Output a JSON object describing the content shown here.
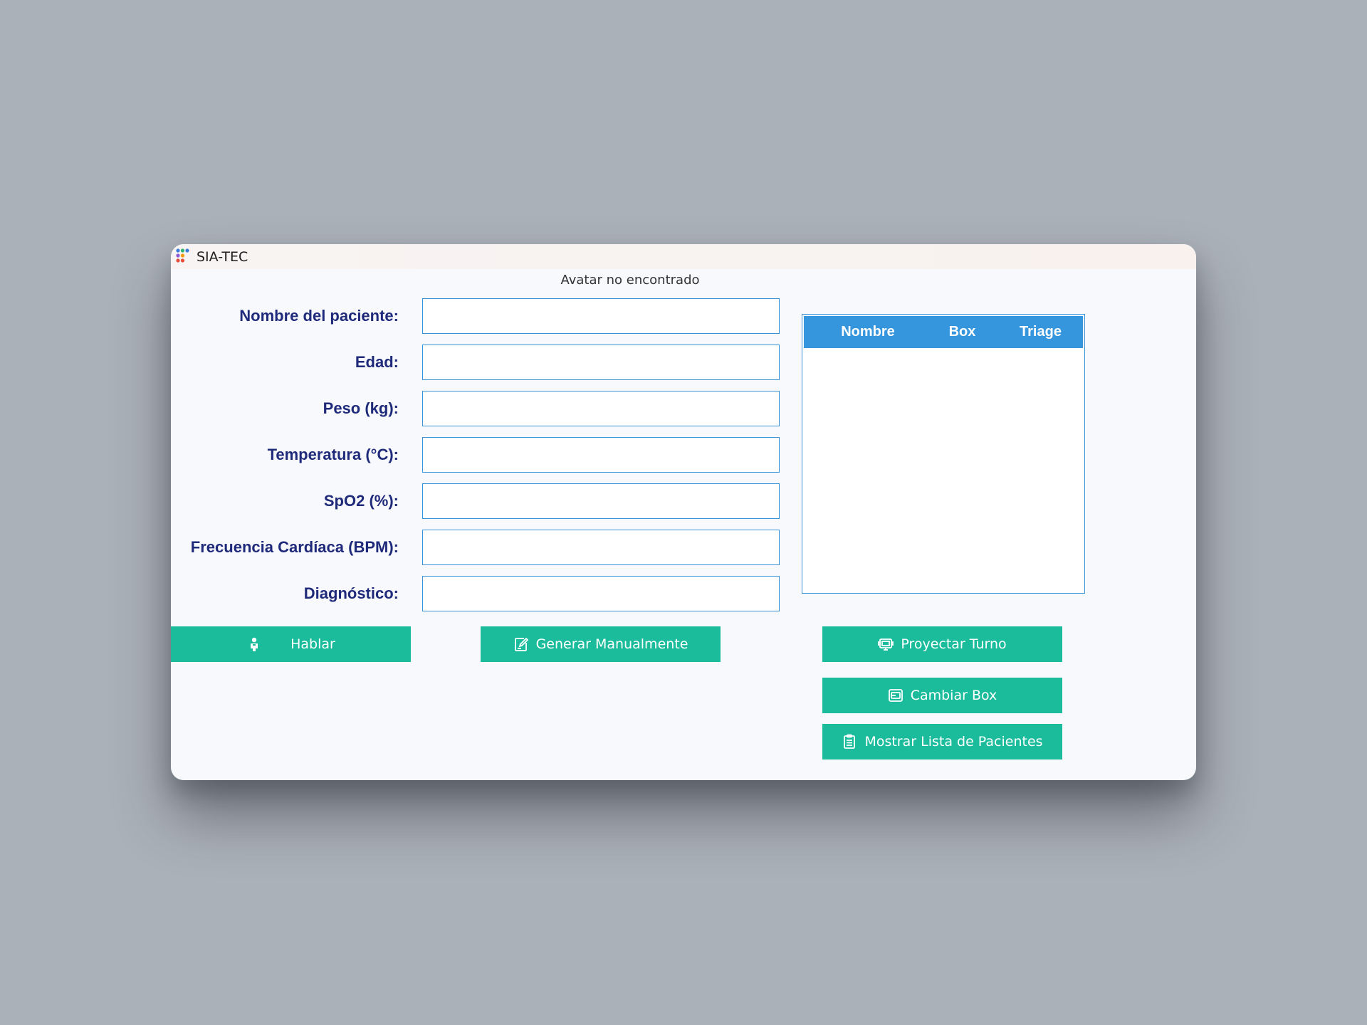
{
  "window": {
    "title": "SIA-TEC"
  },
  "avatar_message": "Avatar no encontrado",
  "form": {
    "fields": [
      {
        "label": "Nombre del paciente:",
        "value": "",
        "placeholder": ""
      },
      {
        "label": "Edad:",
        "value": "",
        "placeholder": ""
      },
      {
        "label": "Peso (kg):",
        "value": "",
        "placeholder": ""
      },
      {
        "label": "Temperatura (°C):",
        "value": "",
        "placeholder": ""
      },
      {
        "label": "SpO2 (%):",
        "value": "",
        "placeholder": ""
      },
      {
        "label": "Frecuencia Cardíaca (BPM):",
        "value": "",
        "placeholder": ""
      },
      {
        "label": "Diagnóstico:",
        "value": "",
        "placeholder": ""
      }
    ]
  },
  "patients_table": {
    "columns": [
      "Nombre",
      "Box",
      "Triage"
    ],
    "rows": []
  },
  "buttons": {
    "hablar": {
      "label": "Hablar",
      "icon": "person-icon"
    },
    "generar": {
      "label": "Generar Manualmente",
      "icon": "edit-icon"
    },
    "proyectar": {
      "label": "Proyectar Turno",
      "icon": "monitor-icon"
    },
    "cambiar_box": {
      "label": "Cambiar Box",
      "icon": "box-icon"
    },
    "mostrar_lista": {
      "label": "Mostrar Lista de Pacientes",
      "icon": "clipboard-icon"
    }
  },
  "colors": {
    "accent": "#1abc9c",
    "label": "#1f2a7a",
    "table_header": "#3696dd",
    "input_border": "#3a93d6"
  }
}
